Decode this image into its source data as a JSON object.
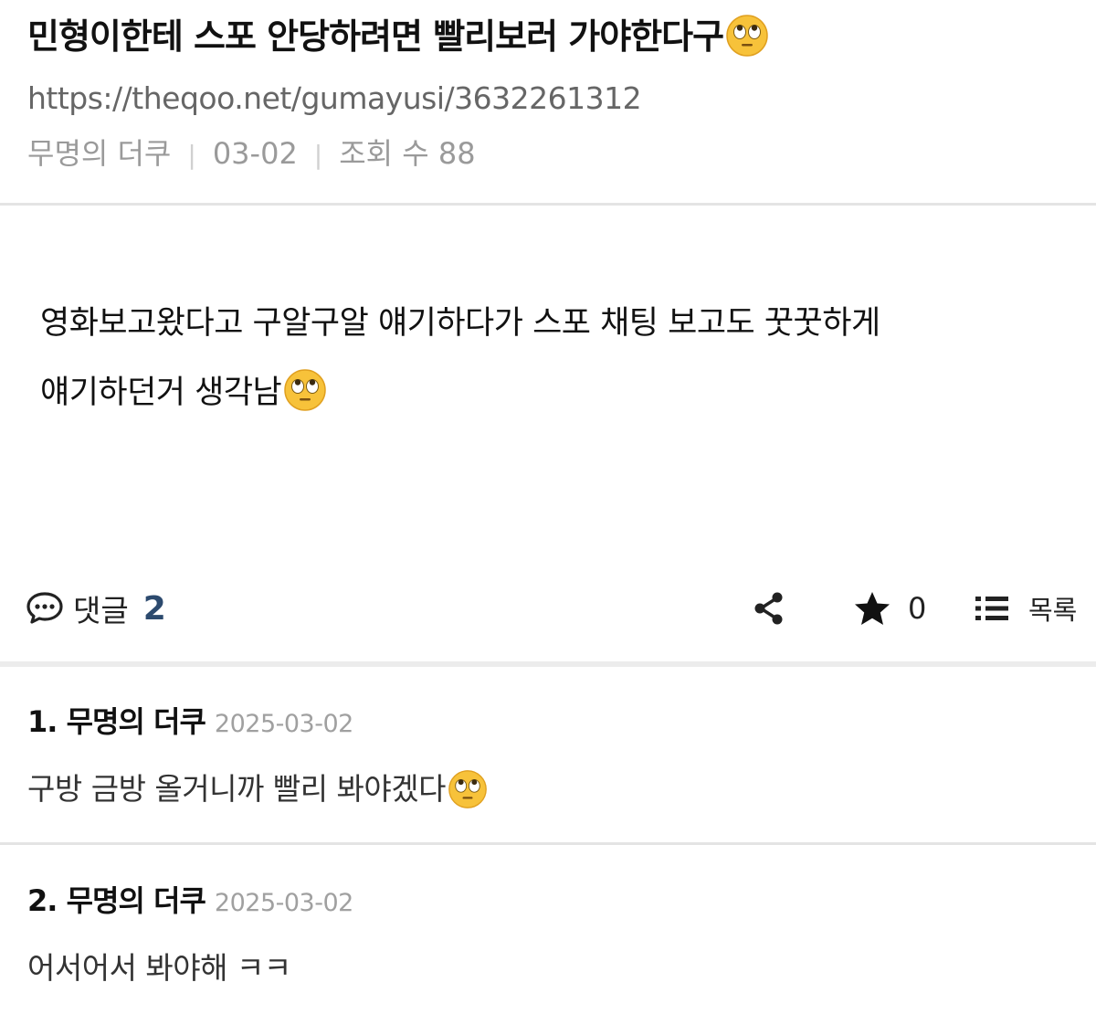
{
  "post": {
    "title": "민형이한테 스포 안당하려면 빨리보러 가야한다구",
    "title_emoji": "eye-roll-emoji",
    "url": "https://theqoo.net/gumayusi/3632261312",
    "author": "무명의 더쿠",
    "date": "03-02",
    "views_label": "조회 수",
    "views": "88",
    "body_line1": "영화보고왔다고 구알구알 얘기하다가 스포 채팅 보고도 꿋꿋하게",
    "body_line2": "얘기하던거 생각남",
    "body_emoji": "eye-roll-emoji"
  },
  "actions": {
    "comment_label": "댓글",
    "comment_count": "2",
    "share_icon": "share-icon",
    "star_icon": "star-icon",
    "star_count": "0",
    "list_icon": "list-icon",
    "list_label": "목록"
  },
  "comments": [
    {
      "index": "1.",
      "author": "무명의 더쿠",
      "date": "2025-03-02",
      "text": "구방 금방 올거니까 빨리 봐야겠다",
      "emoji": "eye-roll-emoji"
    },
    {
      "index": "2.",
      "author": "무명의 더쿠",
      "date": "2025-03-02",
      "text": "어서어서 봐야해 ㅋㅋ"
    }
  ],
  "colors": {
    "comment_count": "#2c4a6e",
    "meta_gray": "#9a9a9a",
    "divider": "#e4e4e4"
  }
}
